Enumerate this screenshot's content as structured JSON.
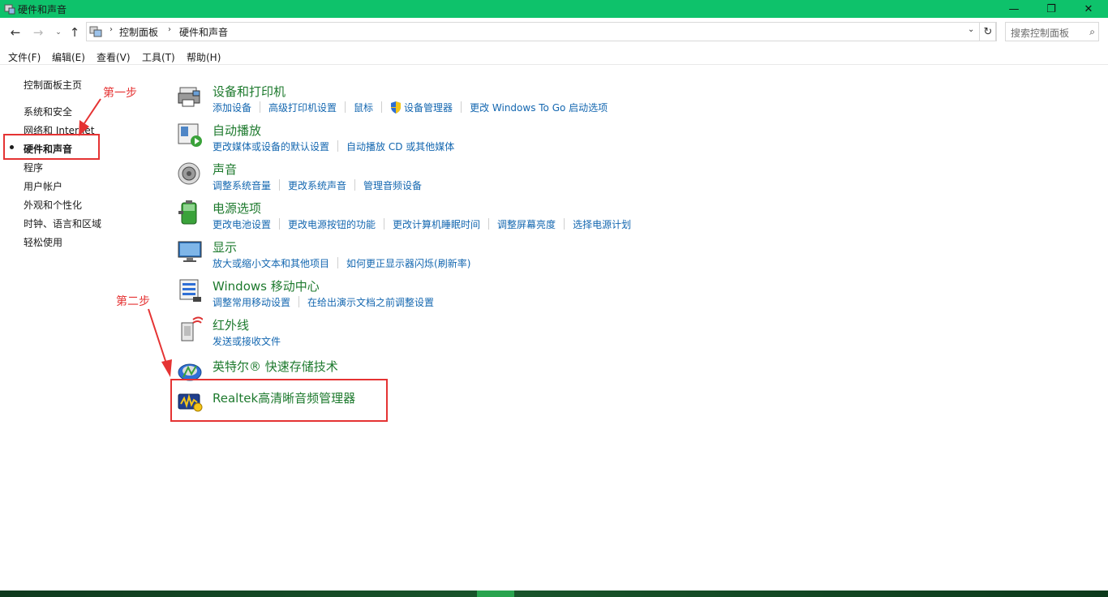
{
  "window": {
    "title": "硬件和声音",
    "minimize_label": "—",
    "maximize_label": "❐",
    "close_label": "✕",
    "titlebar_color": "#0ec26b"
  },
  "address": {
    "back_icon": "←",
    "forward_icon": "→",
    "recent_icon": "⌄",
    "up_icon": "↑",
    "separator": "›",
    "crumbs": [
      "控制面板",
      "硬件和声音"
    ],
    "dropdown_icon": "⌄",
    "refresh_icon": "↻",
    "search_placeholder": "搜索控制面板",
    "search_icon": "⌕"
  },
  "menu": [
    "文件(F)",
    "编辑(E)",
    "查看(V)",
    "工具(T)",
    "帮助(H)"
  ],
  "sidebar": {
    "items": [
      {
        "label": "控制面板主页"
      },
      {
        "label": "系统和安全"
      },
      {
        "label": "网络和 Internet"
      },
      {
        "label": "硬件和声音",
        "active": true
      },
      {
        "label": "程序"
      },
      {
        "label": "用户帐户"
      },
      {
        "label": "外观和个性化"
      },
      {
        "label": "时钟、语言和区域"
      },
      {
        "label": "轻松使用"
      }
    ]
  },
  "categories": [
    {
      "icon": "printer-icon",
      "title": "设备和打印机",
      "links": [
        "添加设备",
        "高级打印机设置",
        "鼠标",
        "设备管理器",
        "更改 Windows To Go 启动选项"
      ]
    },
    {
      "icon": "autoplay-icon",
      "title": "自动播放",
      "links": [
        "更改媒体或设备的默认设置",
        "自动播放 CD 或其他媒体"
      ]
    },
    {
      "icon": "speaker-icon",
      "title": "声音",
      "links": [
        "调整系统音量",
        "更改系统声音",
        "管理音频设备"
      ]
    },
    {
      "icon": "battery-icon",
      "title": "电源选项",
      "links": [
        "更改电池设置",
        "更改电源按钮的功能",
        "更改计算机睡眠时间",
        "调整屏幕亮度",
        "选择电源计划"
      ]
    },
    {
      "icon": "display-icon",
      "title": "显示",
      "links": [
        "放大或缩小文本和其他项目",
        "如何更正显示器闪烁(刷新率)"
      ]
    },
    {
      "icon": "mobility-center-icon",
      "title": "Windows 移动中心",
      "links": [
        "调整常用移动设置",
        "在给出演示文档之前调整设置"
      ]
    },
    {
      "icon": "infrared-icon",
      "title": "红外线",
      "links": [
        "发送或接收文件"
      ]
    },
    {
      "icon": "intel-storage-icon",
      "title": "英特尔® 快速存储技术",
      "links": []
    },
    {
      "icon": "realtek-audio-icon",
      "title": "Realtek高清晰音频管理器",
      "links": []
    }
  ],
  "annotations": {
    "step1": "第一步",
    "step2": "第二步",
    "color": "#e53333"
  }
}
